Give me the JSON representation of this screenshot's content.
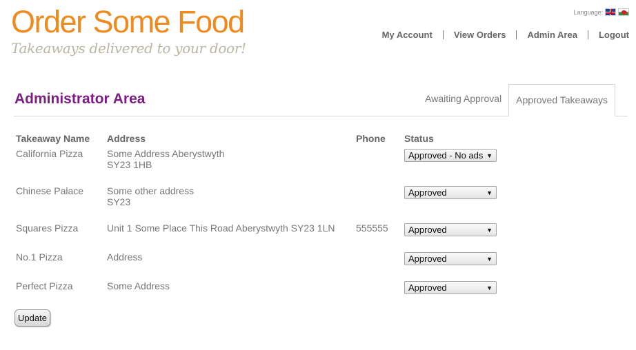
{
  "site": {
    "title": "Order Some Food",
    "tagline": "Takeaways delivered to your door!"
  },
  "language": {
    "label": "Language:",
    "flags": [
      "uk-flag-icon",
      "wales-flag-icon"
    ]
  },
  "nav": {
    "items": [
      {
        "label": "My Account"
      },
      {
        "label": "View Orders"
      },
      {
        "label": "Admin Area"
      },
      {
        "label": "Logout"
      }
    ]
  },
  "page": {
    "title": "Administrator Area"
  },
  "tabs": [
    {
      "label": "Awaiting Approval",
      "active": false
    },
    {
      "label": "Approved Takeaways",
      "active": true
    }
  ],
  "table": {
    "headers": {
      "name": "Takeaway Name",
      "address": "Address",
      "phone": "Phone",
      "status": "Status"
    },
    "rows": [
      {
        "name": "California Pizza",
        "address1": "Some Address Aberystwyth",
        "address2": "SY23 1HB",
        "phone": "",
        "status": "Approved - No ads"
      },
      {
        "name": "Chinese Palace",
        "address1": "Some other address",
        "address2": "SY23",
        "phone": "",
        "status": "Approved"
      },
      {
        "name": "Squares Pizza",
        "address1": "Unit 1 Some Place This Road Aberystwyth SY23 1LN",
        "address2": "",
        "phone": "555555",
        "status": "Approved"
      },
      {
        "name": "No.1 Pizza",
        "address1": "Address",
        "address2": "",
        "phone": "",
        "status": "Approved"
      },
      {
        "name": "Perfect Pizza",
        "address1": "Some Address",
        "address2": "",
        "phone": "",
        "status": "Approved"
      }
    ]
  },
  "actions": {
    "update_label": "Update"
  },
  "colors": {
    "brand_orange": "#ef8a1f",
    "heading_purple": "#7a1e82",
    "tagline_gray": "#b9b6a4"
  }
}
